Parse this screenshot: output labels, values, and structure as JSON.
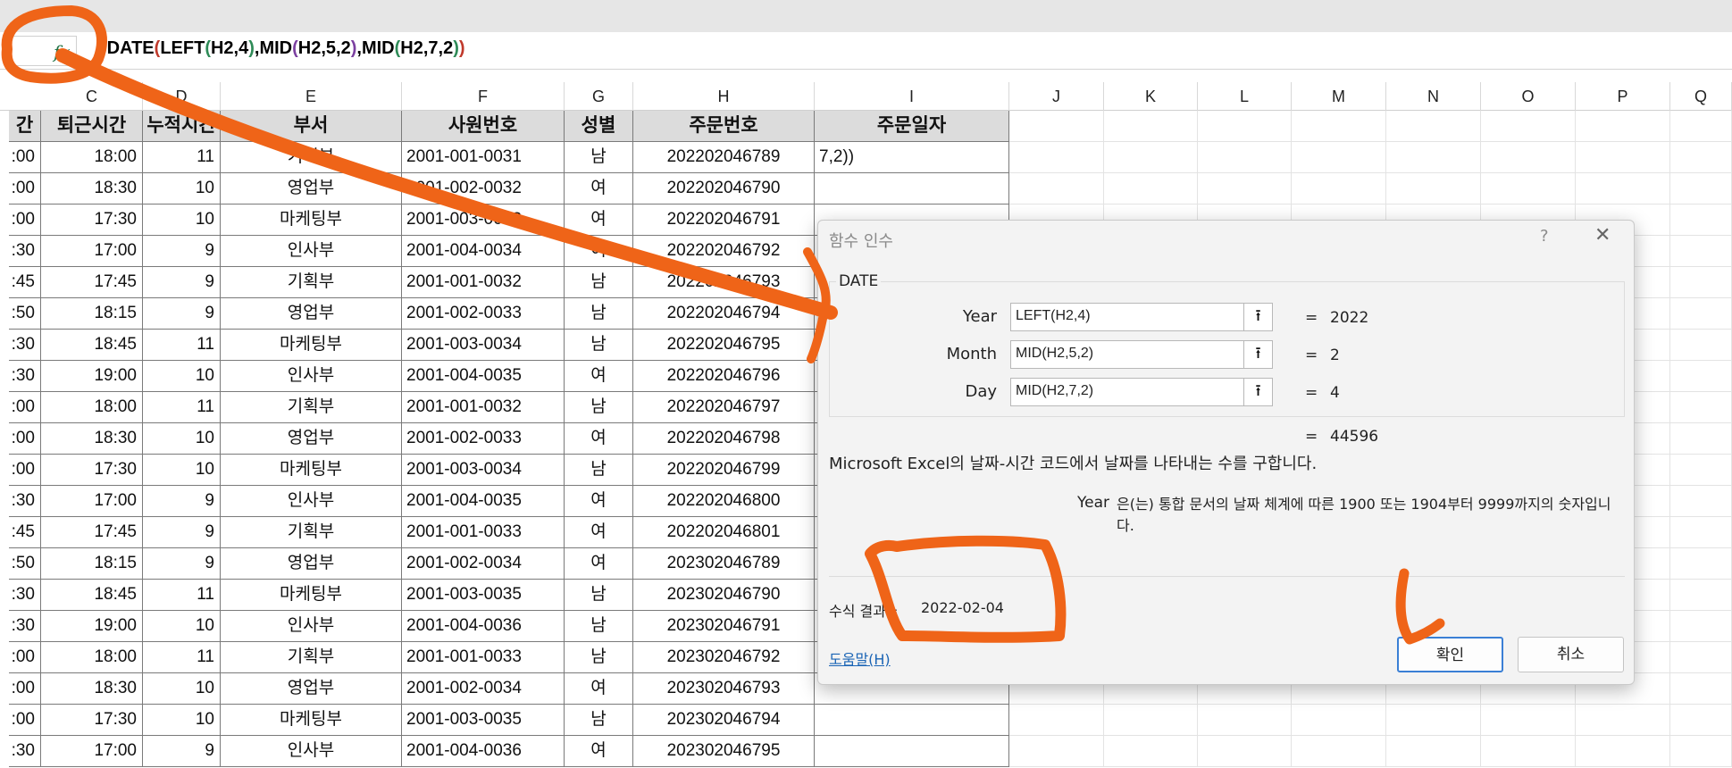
{
  "formula_bar": {
    "fx_icon": "fx-icon",
    "parts": [
      "=DATE",
      "(",
      "LEFT",
      "(",
      "H2,4",
      ")",
      ",MID",
      "(",
      "H2,5,2",
      ")",
      ",MID",
      "(",
      "H2,7,2",
      ")",
      ")"
    ]
  },
  "columns": [
    "C",
    "D",
    "E",
    "F",
    "G",
    "H",
    "I",
    "J",
    "K",
    "L",
    "M",
    "N",
    "O",
    "P",
    "Q"
  ],
  "table": {
    "headers": [
      "간",
      "퇴근시간",
      "누적시간",
      "부서",
      "사원번호",
      "성별",
      "주문번호",
      "주문일자"
    ],
    "rows": [
      [
        ":00",
        "18:00",
        "11",
        "기획부",
        "2001-001-0031",
        "남",
        "202202046789",
        "7,2))"
      ],
      [
        ":00",
        "18:30",
        "10",
        "영업부",
        "2001-002-0032",
        "여",
        "202202046790",
        ""
      ],
      [
        ":00",
        "17:30",
        "10",
        "마케팅부",
        "2001-003-0033",
        "여",
        "202202046791",
        ""
      ],
      [
        ":30",
        "17:00",
        "9",
        "인사부",
        "2001-004-0034",
        "여",
        "202202046792",
        ""
      ],
      [
        ":45",
        "17:45",
        "9",
        "기획부",
        "2001-001-0032",
        "남",
        "202202046793",
        ""
      ],
      [
        ":50",
        "18:15",
        "9",
        "영업부",
        "2001-002-0033",
        "남",
        "202202046794",
        ""
      ],
      [
        ":30",
        "18:45",
        "11",
        "마케팅부",
        "2001-003-0034",
        "남",
        "202202046795",
        ""
      ],
      [
        ":30",
        "19:00",
        "10",
        "인사부",
        "2001-004-0035",
        "여",
        "202202046796",
        ""
      ],
      [
        ":00",
        "18:00",
        "11",
        "기획부",
        "2001-001-0032",
        "남",
        "202202046797",
        ""
      ],
      [
        ":00",
        "18:30",
        "10",
        "영업부",
        "2001-002-0033",
        "여",
        "202202046798",
        ""
      ],
      [
        ":00",
        "17:30",
        "10",
        "마케팅부",
        "2001-003-0034",
        "남",
        "202202046799",
        ""
      ],
      [
        ":30",
        "17:00",
        "9",
        "인사부",
        "2001-004-0035",
        "여",
        "202202046800",
        ""
      ],
      [
        ":45",
        "17:45",
        "9",
        "기획부",
        "2001-001-0033",
        "여",
        "202202046801",
        ""
      ],
      [
        ":50",
        "18:15",
        "9",
        "영업부",
        "2001-002-0034",
        "여",
        "202302046789",
        ""
      ],
      [
        ":30",
        "18:45",
        "11",
        "마케팅부",
        "2001-003-0035",
        "남",
        "202302046790",
        ""
      ],
      [
        ":30",
        "19:00",
        "10",
        "인사부",
        "2001-004-0036",
        "남",
        "202302046791",
        ""
      ],
      [
        ":00",
        "18:00",
        "11",
        "기획부",
        "2001-001-0033",
        "남",
        "202302046792",
        ""
      ],
      [
        ":00",
        "18:30",
        "10",
        "영업부",
        "2001-002-0034",
        "여",
        "202302046793",
        ""
      ],
      [
        ":00",
        "17:30",
        "10",
        "마케팅부",
        "2001-003-0035",
        "남",
        "202302046794",
        ""
      ],
      [
        ":30",
        "17:00",
        "9",
        "인사부",
        "2001-004-0036",
        "여",
        "202302046795",
        ""
      ]
    ]
  },
  "dialog": {
    "title": "함수 인수",
    "help_glyph": "?",
    "close_glyph": "✕",
    "function_name": "DATE",
    "args": [
      {
        "label": "Year",
        "value": "LEFT(H2,4)",
        "result": "2022"
      },
      {
        "label": "Month",
        "value": "MID(H2,5,2)",
        "result": "2"
      },
      {
        "label": "Day",
        "value": "MID(H2,7,2)",
        "result": "4"
      }
    ],
    "equals": "=",
    "upload_glyph": "⭱",
    "total_result": "44596",
    "description": "Microsoft Excel의 날짜-시간 코드에서 날짜를 나타내는 수를 구합니다.",
    "arg_desc_name": "Year",
    "arg_desc_text": "은(는) 통합 문서의 날짜 체계에 따른 1900 또는 1904부터 9999까지의 숫자입니다.",
    "formula_result_label": "수식 결과=",
    "formula_result_value": "2022-02-04",
    "help_link": "도움말(H)",
    "ok_label": "확인",
    "cancel_label": "취소"
  },
  "colors": {
    "annotation": "#ef6418",
    "header_fill": "#dcdcdc",
    "ok_border": "#3a7fd5",
    "link": "#1a64b5"
  }
}
